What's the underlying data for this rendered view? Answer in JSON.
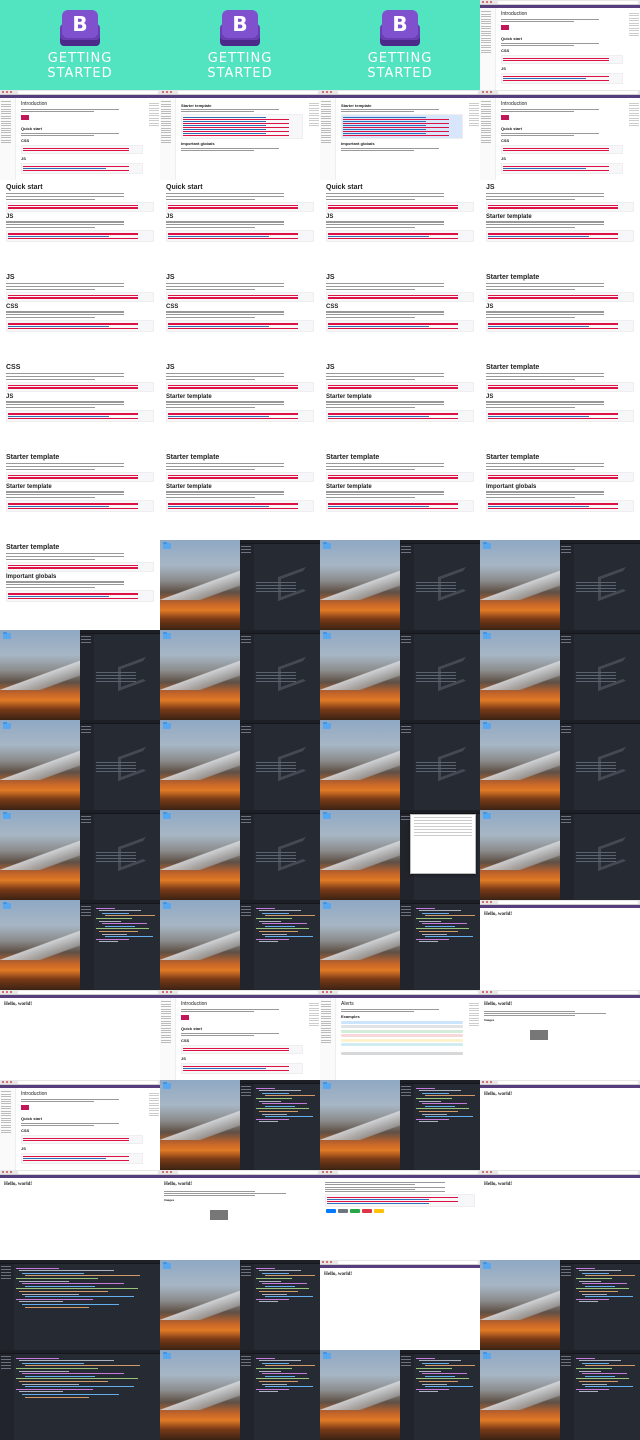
{
  "title_card": {
    "logo_letter": "B",
    "line1": "GETTING",
    "line2": "STARTED"
  },
  "docs": {
    "h_intro": "Introduction",
    "h_quick_start": "Quick start",
    "h_css": "CSS",
    "h_js": "JS",
    "h_starter": "Starter template",
    "h_globals": "Important globals",
    "h_alerts": "Alerts",
    "h_examples": "Examples",
    "h_images": "Images"
  },
  "plain": {
    "hello": "Hello, world!"
  },
  "icons": {
    "folder": "folder-icon",
    "bootstrap": "bootstrap-logo-icon",
    "vscode": "vscode-logo-icon"
  },
  "colors": {
    "title_bg": "#52e3c1",
    "bootstrap_purple": "#7f51cf",
    "nav_purple": "#563d7c",
    "editor_bg": "#262a33",
    "link_blue": "#2f6fb5",
    "code_red": "#d14"
  }
}
